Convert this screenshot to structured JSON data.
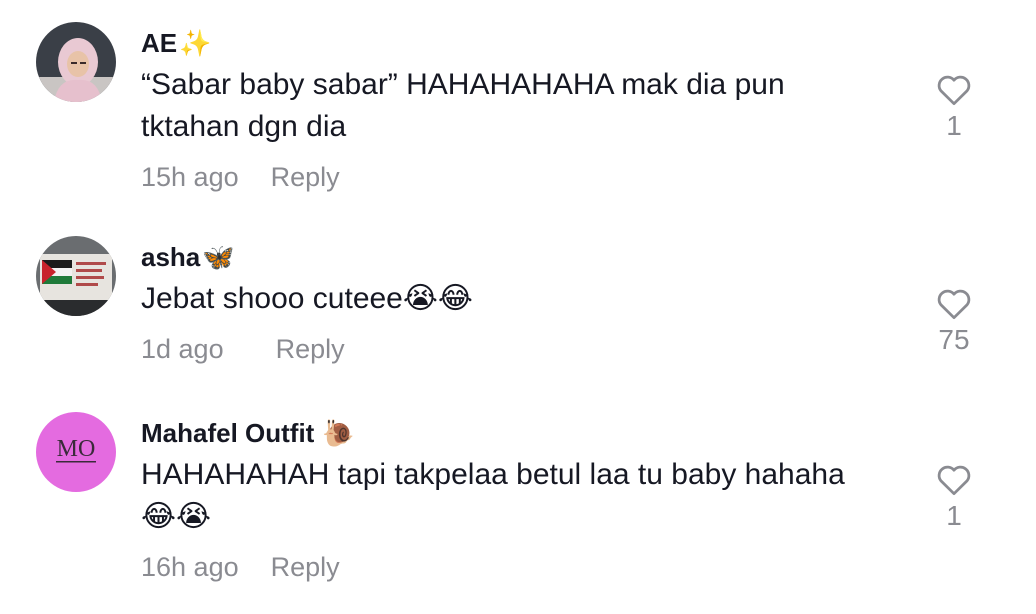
{
  "comments": [
    {
      "username": "AE",
      "username_emoji": "✨",
      "text": "“Sabar baby sabar” HAHAHAHAHA mak dia pun tktahan dgn dia",
      "time": "15h ago",
      "reply_label": "Reply",
      "likes": "1",
      "avatar_icon": "woman-hijab-avatar"
    },
    {
      "username": "asha",
      "username_emoji": "🦋",
      "text": "Jebat shooo cuteee😭😂",
      "time": "1d ago",
      "reply_label": "Reply",
      "likes": "75",
      "avatar_icon": "palestine-flag-avatar"
    },
    {
      "username": "Mahafel Outfit",
      "username_emoji": "🐌",
      "text": "HAHAHAHAH tapi takpelaa betul laa tu baby hahaha 😂😭",
      "time": "16h ago",
      "reply_label": "Reply",
      "likes": "1",
      "avatar_icon": "mo-logo-avatar"
    }
  ],
  "colors": {
    "text": "#161823",
    "secondary": "#8a8b91",
    "mahafel_avatar_bg": "#e46be0"
  }
}
